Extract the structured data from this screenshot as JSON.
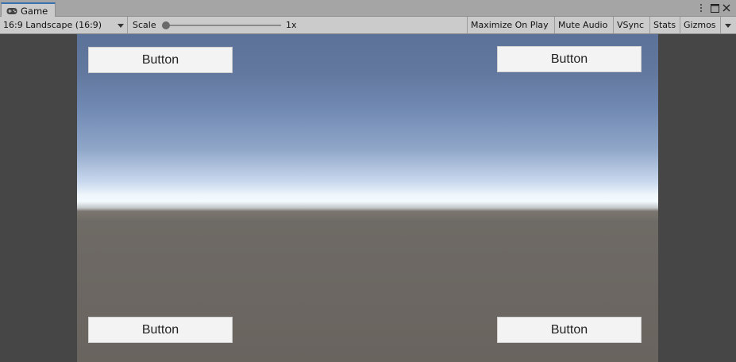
{
  "window": {
    "tab_label": "Game",
    "tab_icon": "gamepad-icon",
    "controls": [
      "more-options-icon",
      "maximize-icon",
      "close-icon"
    ]
  },
  "toolbar": {
    "aspect_dropdown": "16:9 Landscape (16:9)",
    "scale_label": "Scale",
    "scale_value_label": "1x",
    "scale_level": 0,
    "maximize_on_play": "Maximize On Play",
    "mute_audio": "Mute Audio",
    "vsync": "VSync",
    "stats": "Stats",
    "gizmos": "Gizmos"
  },
  "game_view": {
    "buttons": {
      "top_left": "Button",
      "top_right": "Button",
      "bottom_left": "Button",
      "bottom_right": "Button"
    },
    "colors": {
      "sky_top": "#5b7299",
      "horizon": "#f4fbff",
      "ground": "#6a645f",
      "letterbox": "#464646"
    }
  }
}
